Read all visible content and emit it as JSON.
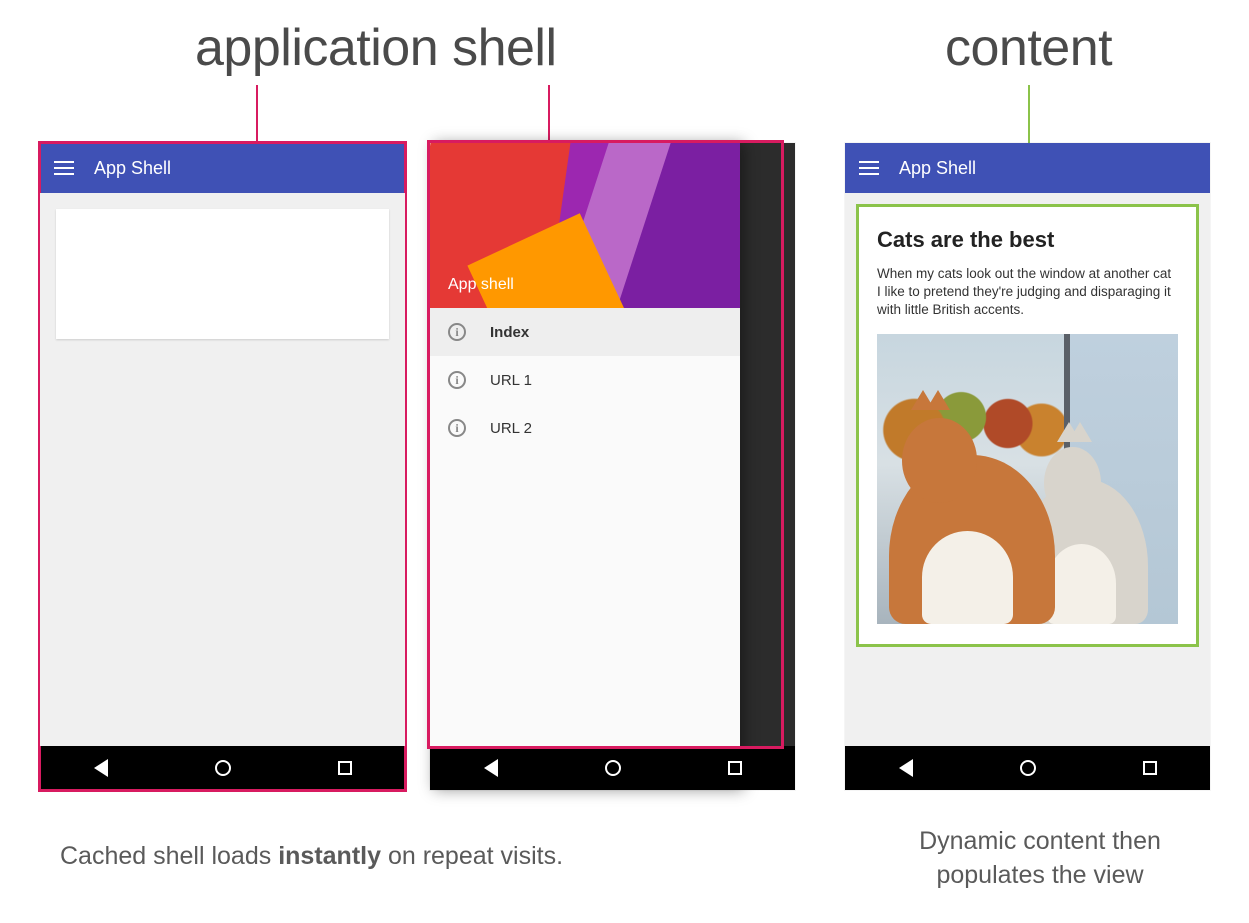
{
  "labels": {
    "shell_heading": "application shell",
    "content_heading": "content",
    "caption_left_pre": "Cached shell loads ",
    "caption_left_strong": "instantly",
    "caption_left_post": " on repeat visits.",
    "caption_right": "Dynamic content then populates the view"
  },
  "appbar": {
    "title": "App Shell"
  },
  "drawer": {
    "header_label": "App shell",
    "items": [
      {
        "label": "Index",
        "selected": true
      },
      {
        "label": "URL 1",
        "selected": false
      },
      {
        "label": "URL 2",
        "selected": false
      }
    ]
  },
  "content": {
    "title": "Cats are the best",
    "body": "When my cats look out the window at another cat I like to pretend they're judging and disparaging it with little British accents."
  },
  "colors": {
    "pink": "#d81b60",
    "green": "#8bc34a",
    "appbar": "#3f51b5"
  }
}
